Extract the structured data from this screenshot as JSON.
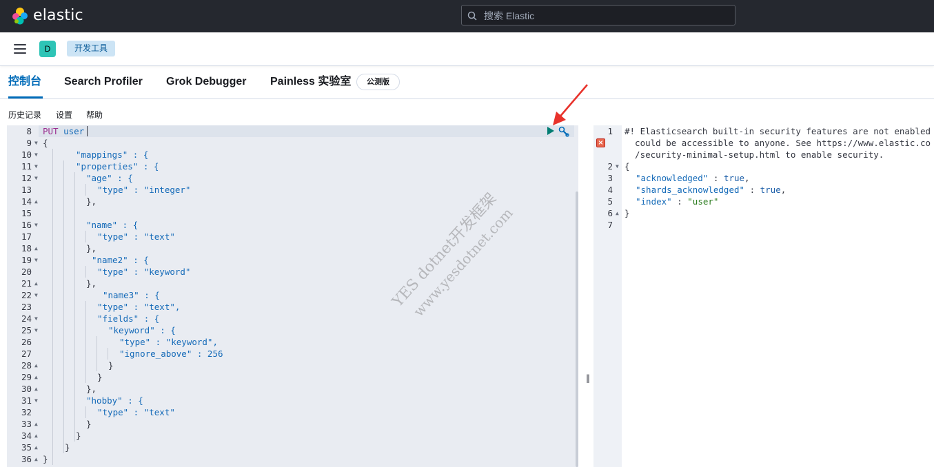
{
  "header": {
    "brand": "elastic",
    "search_placeholder": "搜索 Elastic"
  },
  "subbar": {
    "space_initial": "D",
    "breadcrumb": "开发工具"
  },
  "tabs": [
    {
      "label": "控制台",
      "active": true
    },
    {
      "label": "Search Profiler",
      "active": false
    },
    {
      "label": "Grok Debugger",
      "active": false
    },
    {
      "label": "Painless 实验室",
      "active": false
    }
  ],
  "beta_badge": "公测版",
  "menu": [
    "历史记录",
    "设置",
    "帮助"
  ],
  "editor": {
    "line_numbers": [
      "8",
      "9",
      "10",
      "11",
      "12",
      "13",
      "14",
      "15",
      "16",
      "17",
      "18",
      "19",
      "20",
      "21",
      "22",
      "23",
      "24",
      "25",
      "26",
      "27",
      "28",
      "29",
      "30",
      "31",
      "32",
      "33",
      "34",
      "35",
      "36"
    ],
    "method": "PUT",
    "path": "user",
    "lines": [
      "{",
      "\"mappings\" : {",
      "\"properties\" : {",
      "\"age\" : {",
      "\"type\" : \"integer\"",
      "},",
      "",
      "\"name\" : {",
      "\"type\" : \"text\"",
      "},",
      "\"name2\" : {",
      "\"type\" : \"keyword\"",
      "},",
      "\"name3\" : {",
      "\"type\" : \"text\",",
      "\"fields\" : {",
      "\"keyword\" : {",
      "\"type\" : \"keyword\",",
      "\"ignore_above\" : 256",
      "}",
      "}",
      "},",
      "\"hobby\" : {",
      "\"type\" : \"text\"",
      "}",
      "}",
      "}",
      "}"
    ]
  },
  "output": {
    "line_numbers": [
      "1",
      "2",
      "3",
      "4",
      "5",
      "6",
      "7"
    ],
    "warning_lines": [
      "#! Elasticsearch built-in security features are not enabled",
      "  could be accessible to anyone. See https://www.elastic.co",
      "  /security-minimal-setup.html to enable security."
    ],
    "open": "{",
    "ack_key": "\"acknowledged\"",
    "ack_val": "true",
    "shards_key": "\"shards_acknowledged\"",
    "shards_val": "true",
    "index_key": "\"index\"",
    "index_val": "\"user\"",
    "close": "}"
  },
  "watermark": {
    "line1": "YES dotnet开发框架",
    "line2": "www.yesdotnet.com"
  },
  "colors": {
    "accent": "#006bb8",
    "header_bg": "#25282f",
    "run": "#017d73",
    "annotation_arrow": "#e8322b"
  }
}
